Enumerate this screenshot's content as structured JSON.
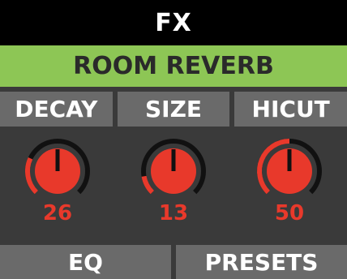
{
  "header": {
    "title": "FX"
  },
  "effect": {
    "name": "ROOM REVERB"
  },
  "params": [
    {
      "label": "DECAY",
      "value": "26",
      "level": 0.26
    },
    {
      "label": "SIZE",
      "value": "13",
      "level": 0.13
    },
    {
      "label": "HICUT",
      "value": "50",
      "level": 0.5
    }
  ],
  "footer": {
    "eq_label": "EQ",
    "presets_label": "PRESETS"
  },
  "colors": {
    "header_bg": "#000000",
    "name_bg": "#8dc655",
    "panel_bg": "#6a6a6a",
    "knob_red": "#e8392b",
    "track_dark": "#111111"
  }
}
